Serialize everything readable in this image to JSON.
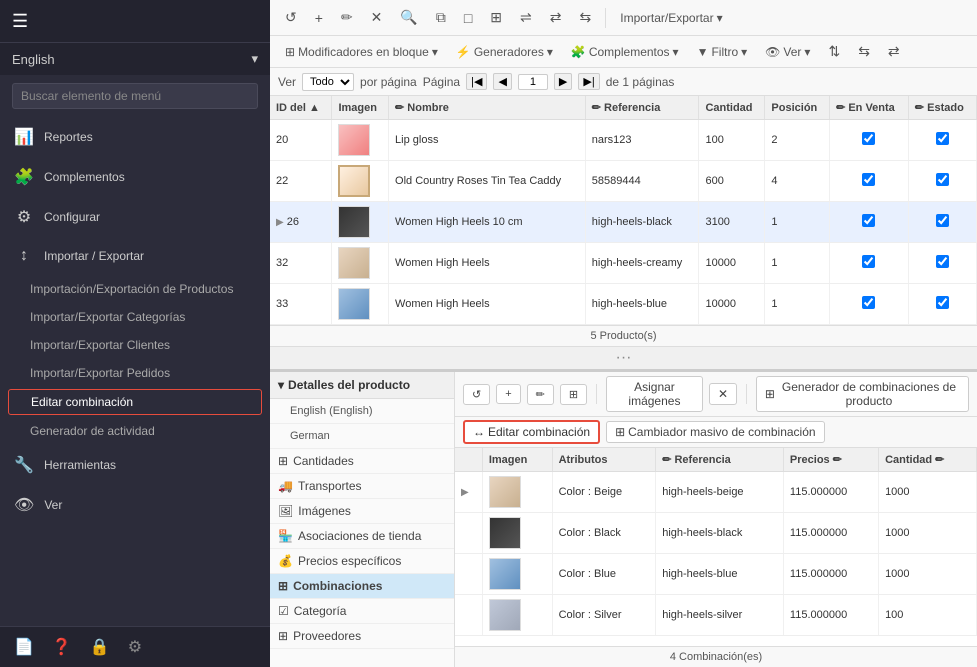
{
  "sidebar": {
    "hamburger": "☰",
    "logo": "",
    "lang_label": "English",
    "lang_arrow": "▾",
    "search_placeholder": "Buscar elemento de menú",
    "nav_items": [
      {
        "id": "reportes",
        "icon": "📊",
        "label": "Reportes"
      },
      {
        "id": "complementos",
        "icon": "🧩",
        "label": "Complementos"
      },
      {
        "id": "configurar",
        "icon": "⚙",
        "label": "Configurar"
      },
      {
        "id": "importar",
        "icon": "↕",
        "label": "Importar / Exportar",
        "expanded": true
      }
    ],
    "sub_items": [
      {
        "id": "imp-productos",
        "label": "Importación/Exportación de Productos",
        "active": false
      },
      {
        "id": "imp-categorias",
        "label": "Importar/Exportar Categorías",
        "active": false
      },
      {
        "id": "imp-clientes",
        "label": "Importar/Exportar Clientes",
        "active": false
      },
      {
        "id": "imp-pedidos",
        "label": "Importar/Exportar Pedidos",
        "active": false
      },
      {
        "id": "editar-combo",
        "label": "Editar combinación",
        "active": true
      },
      {
        "id": "gen-actividad",
        "label": "Generador de actividad",
        "active": false
      }
    ],
    "nav_bottom": [
      {
        "id": "herramientas",
        "icon": "🔧",
        "label": "Herramientas"
      },
      {
        "id": "ver",
        "icon": "👁",
        "label": "Ver"
      }
    ],
    "bottom_icons": [
      "📄",
      "❓",
      "🔒",
      "⚙"
    ]
  },
  "toolbar": {
    "buttons": [
      "↺",
      "+",
      "✏",
      "✕",
      "🔍",
      "⧉",
      "□",
      "⊞",
      "⇌",
      "⇄",
      "⇆"
    ],
    "importar_label": "Importar/Exportar",
    "modificadores_label": "Modificadores en bloque",
    "generadores_label": "Generadores",
    "complementos_label": "Complementos",
    "filtro_label": "Filtro",
    "ver_label": "Ver"
  },
  "pagination": {
    "ver_label": "Ver",
    "todo_option": "Todo",
    "por_pagina": "por página",
    "pagina_label": "Página",
    "page_num": "1",
    "de_label": "de",
    "paginas_count": "1",
    "paginas_suffix": "páginas"
  },
  "products_table": {
    "columns": [
      "ID del ▲",
      "Imagen",
      "✏ Nombre",
      "✏ Referencia",
      "Cantidad",
      "Posición",
      "✏ En Venta",
      "✏ Estado"
    ],
    "rows": [
      {
        "id": "20",
        "img_class": "img-lipgloss",
        "nombre": "Lip gloss",
        "referencia": "nars123",
        "cantidad": "100",
        "posicion": "2",
        "en_venta": true,
        "estado": true
      },
      {
        "id": "22",
        "img_class": "img-teacaddy",
        "nombre": "Old Country Roses Tin Tea Caddy",
        "referencia": "58589444",
        "cantidad": "600",
        "posicion": "4",
        "en_venta": true,
        "estado": true
      },
      {
        "id": "26",
        "img_class": "img-heels-black",
        "nombre": "Women High Heels 10 cm",
        "referencia": "high-heels-black",
        "cantidad": "3100",
        "posicion": "1",
        "en_venta": true,
        "estado": true,
        "selected": true,
        "expanded": true
      },
      {
        "id": "32",
        "img_class": "img-heels-beige",
        "nombre": "Women High Heels",
        "referencia": "high-heels-creamy",
        "cantidad": "10000",
        "posicion": "1",
        "en_venta": true,
        "estado": true
      },
      {
        "id": "33",
        "img_class": "img-heels-blue",
        "nombre": "Women High Heels",
        "referencia": "high-heels-blue",
        "cantidad": "10000",
        "posicion": "1",
        "en_venta": true,
        "estado": true
      }
    ],
    "footer": "5 Producto(s)"
  },
  "detail_panel": {
    "header": "Detalles del producto",
    "lang_items": [
      {
        "label": "English (English)",
        "active": false
      },
      {
        "label": "German",
        "active": false
      }
    ],
    "sections": [
      {
        "icon": "⊞",
        "label": "Cantidades"
      },
      {
        "icon": "🚚",
        "label": "Transportes"
      },
      {
        "icon": "🖼",
        "label": "Imágenes"
      },
      {
        "icon": "🏪",
        "label": "Asociaciones de tienda"
      },
      {
        "icon": "💰",
        "label": "Precios específicos"
      },
      {
        "icon": "⊞",
        "label": "Combinaciones",
        "active": true
      },
      {
        "icon": "☑",
        "label": "Categoría"
      },
      {
        "icon": "⊞",
        "label": "Proveedores"
      }
    ]
  },
  "combo_panel": {
    "toolbar_icons": [
      "↺",
      "+",
      "✏",
      "⊞"
    ],
    "asignar_label": "Asignar imágenes",
    "close_icon": "✕",
    "generator_label": "Generador de combinaciones de producto",
    "editar_btn": "Editar combinación",
    "cambiador_btn": "Cambiador masivo de combinación",
    "columns": [
      "",
      "Imagen",
      "Atributos",
      "✏ Referencia",
      "Precios ✏",
      "Cantidad ✏"
    ],
    "rows": [
      {
        "img_class": "img-heels-beige",
        "atributo": "Color : Beige",
        "referencia": "high-heels-beige",
        "precio": "115.000000",
        "cantidad": "1000"
      },
      {
        "img_class": "img-heels-black",
        "atributo": "Color : Black",
        "referencia": "high-heels-black",
        "precio": "115.000000",
        "cantidad": "1000"
      },
      {
        "img_class": "img-heels-blue",
        "atributo": "Color : Blue",
        "referencia": "high-heels-blue",
        "precio": "115.000000",
        "cantidad": "1000"
      },
      {
        "img_class": "img-heels-beige",
        "atributo": "Color : Silver",
        "referencia": "high-heels-silver",
        "precio": "115.000000",
        "cantidad": "100"
      }
    ],
    "footer": "4 Combinación(es)"
  }
}
